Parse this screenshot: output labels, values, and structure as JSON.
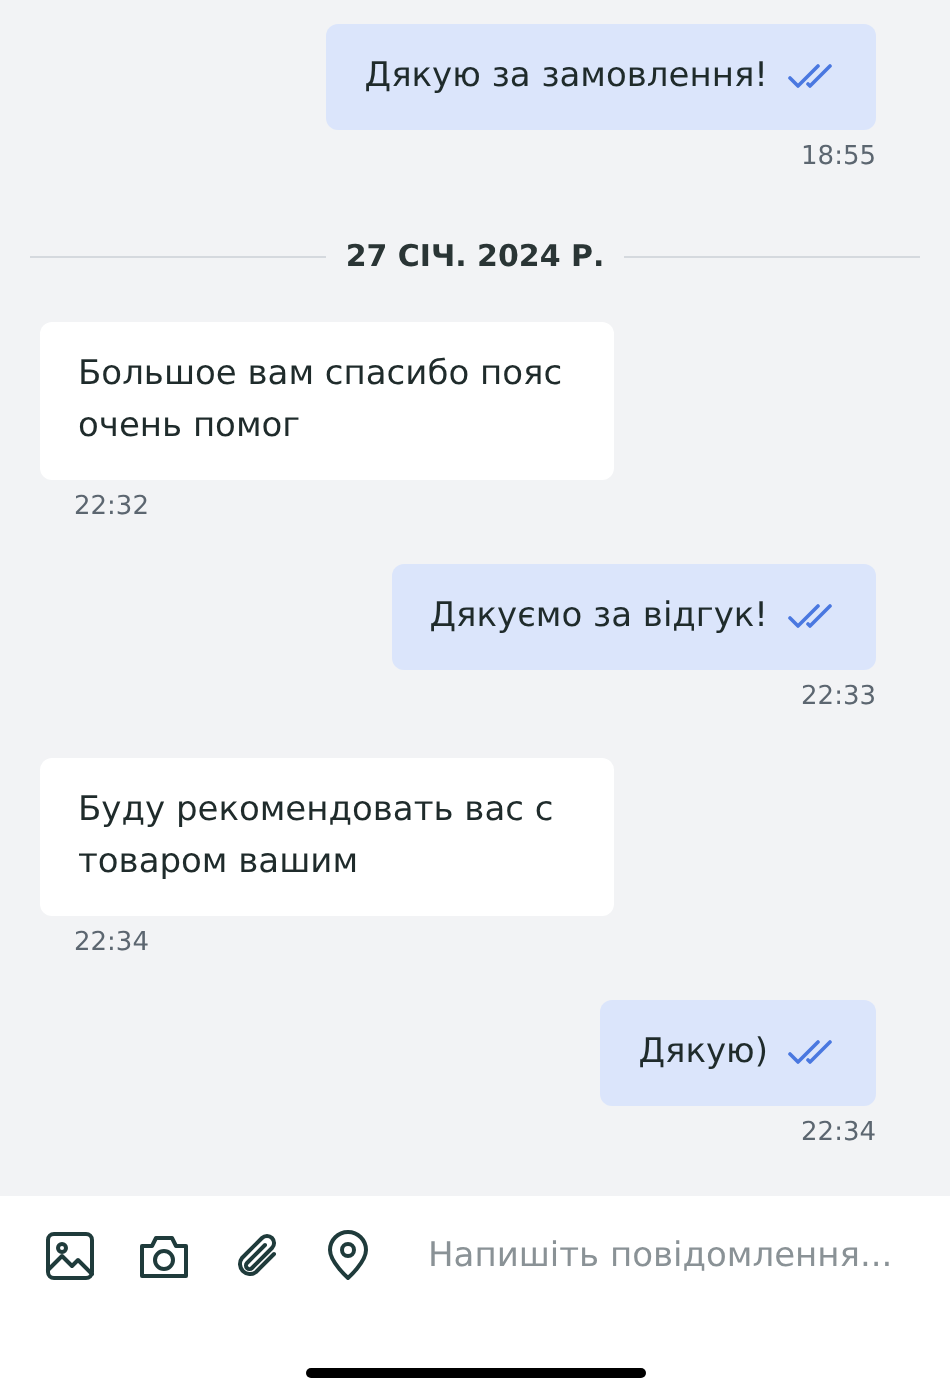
{
  "messages": [
    {
      "kind": "outgoing",
      "text": "Дякую за замовлення!",
      "time": "18:55",
      "read": true
    },
    {
      "kind": "date",
      "text": "27 СІЧ. 2024 Р."
    },
    {
      "kind": "incoming",
      "text": "Большое вам спасибо пояс очень помог",
      "time": "22:32"
    },
    {
      "kind": "outgoing",
      "text": "Дякуємо за відгук!",
      "time": "22:33",
      "read": true
    },
    {
      "kind": "incoming",
      "text": "Буду рекомендовать вас с товаром вашим",
      "time": "22:34"
    },
    {
      "kind": "outgoing",
      "text": "Дякую)",
      "time": "22:34",
      "read": true
    }
  ],
  "composer": {
    "placeholder": "Напишіть повідомлення..."
  }
}
